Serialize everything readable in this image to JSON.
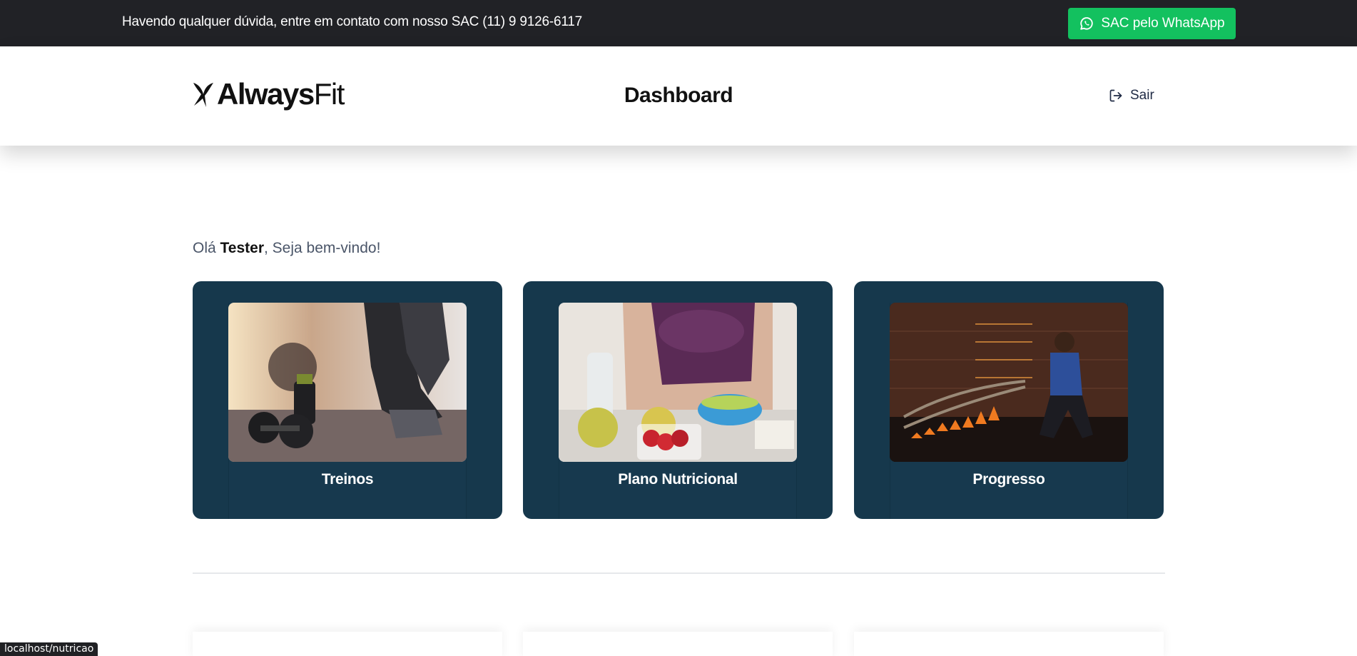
{
  "topbar": {
    "notice": "Havendo qualquer dúvida, entre em contato com nosso SAC (11) 9 9126-6117",
    "whatsapp_label": "SAC pelo WhatsApp",
    "whatsapp_icon": "whatsapp-icon"
  },
  "header": {
    "logo_bold": "Always",
    "logo_light": "Fit",
    "title": "Dashboard",
    "logout_label": "Sair",
    "logout_icon": "logout-icon"
  },
  "greeting": {
    "prefix": "Olá ",
    "name": "Tester",
    "suffix": ", Seja bem-vindo!"
  },
  "cards": [
    {
      "label": "Treinos",
      "image": "workout-photo"
    },
    {
      "label": "Plano Nutricional",
      "image": "nutrition-photo"
    },
    {
      "label": "Progresso",
      "image": "progress-photo"
    }
  ],
  "status_bar": {
    "url": "localhost/nutricao"
  },
  "colors": {
    "topbar_bg": "#212226",
    "whatsapp_green": "#13c15f",
    "card_bg": "#16384c",
    "accent_text": "#1f2a44"
  }
}
